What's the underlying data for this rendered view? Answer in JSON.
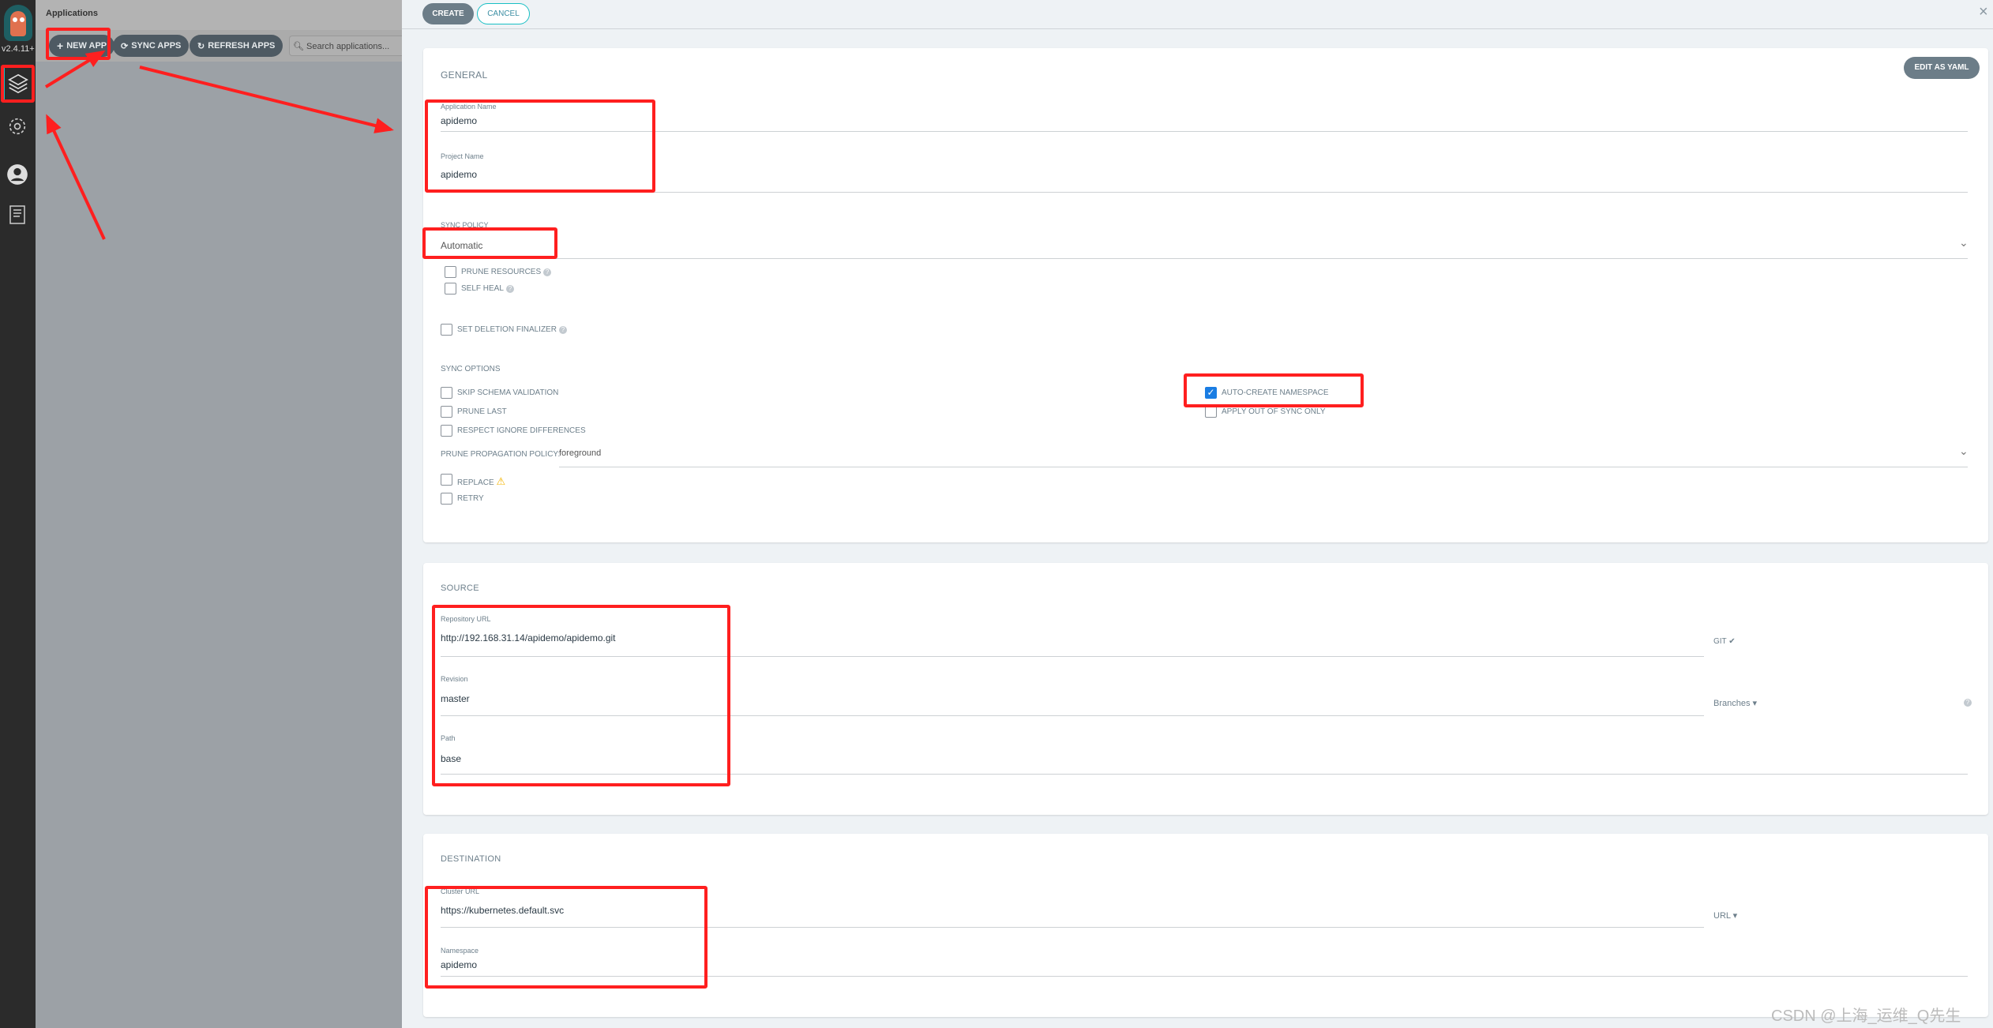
{
  "sidebar": {
    "version": "v2.4.11+",
    "items": [
      {
        "icon": "layers-icon",
        "active": true
      },
      {
        "icon": "gear-icon"
      },
      {
        "icon": "user-icon"
      },
      {
        "icon": "docs-icon"
      }
    ]
  },
  "apps": {
    "title": "Applications",
    "new_app": "NEW APP",
    "sync_apps": "SYNC APPS",
    "refresh_apps": "REFRESH APPS",
    "search_placeholder": "Search applications..."
  },
  "panel": {
    "create": "CREATE",
    "cancel": "CANCEL",
    "edit_yaml": "EDIT AS YAML",
    "general": {
      "title": "GENERAL",
      "app_name_label": "Application Name",
      "app_name": "apidemo",
      "project_label": "Project Name",
      "project": "apidemo",
      "sync_policy_label": "SYNC POLICY",
      "sync_policy": "Automatic",
      "prune_resources": "PRUNE RESOURCES",
      "self_heal": "SELF HEAL",
      "deletion_finalizer": "SET DELETION FINALIZER",
      "sync_options_title": "SYNC OPTIONS",
      "skip_schema": "SKIP SCHEMA VALIDATION",
      "prune_last": "PRUNE LAST",
      "respect_ignore": "RESPECT IGNORE DIFFERENCES",
      "auto_create_ns": "AUTO-CREATE NAMESPACE",
      "auto_create_ns_checked": true,
      "apply_out_of_sync": "APPLY OUT OF SYNC ONLY",
      "prune_propagation_label": "PRUNE PROPAGATION POLICY:",
      "prune_propagation": "foreground",
      "replace": "REPLACE",
      "retry": "RETRY"
    },
    "source": {
      "title": "SOURCE",
      "repo_label": "Repository URL",
      "repo": "http://192.168.31.14/apidemo/apidemo.git",
      "repo_type": "GIT",
      "revision_label": "Revision",
      "revision": "master",
      "revision_type": "Branches",
      "path_label": "Path",
      "path": "base"
    },
    "destination": {
      "title": "DESTINATION",
      "cluster_label": "Cluster URL",
      "cluster": "https://kubernetes.default.svc",
      "cluster_type": "URL",
      "namespace_label": "Namespace",
      "namespace": "apidemo"
    }
  },
  "watermark": "CSDN @上海_运维_Q先生",
  "colors": {
    "annotation": "#ff1f1f",
    "checkbox_checked": "#1a7de3",
    "button": "#6c7d88"
  }
}
